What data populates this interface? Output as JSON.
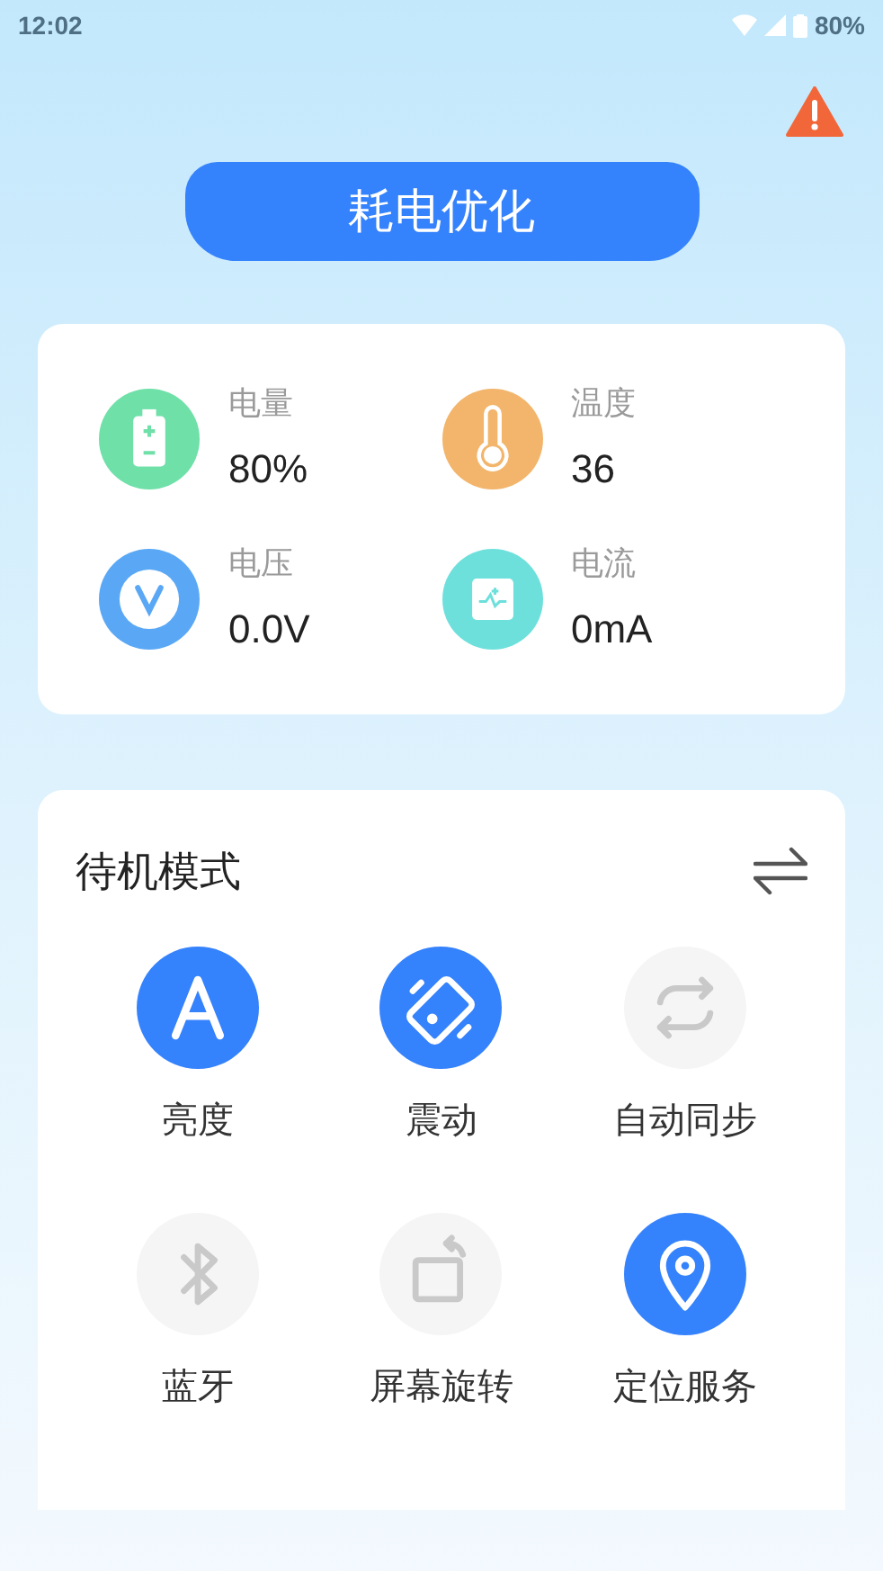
{
  "status_bar": {
    "time": "12:02",
    "battery": "80%"
  },
  "optimize_button": {
    "label": "耗电优化"
  },
  "stats": [
    {
      "kind": "battery",
      "label": "电量",
      "value": "80%",
      "color": "#6ee0a8"
    },
    {
      "kind": "temperature",
      "label": "温度",
      "value": "36",
      "color": "#f2b56b"
    },
    {
      "kind": "voltage",
      "label": "电压",
      "value": "0.0V",
      "color": "#5aa8f5"
    },
    {
      "kind": "current",
      "label": "电流",
      "value": "0mA",
      "color": "#6ee0dc"
    }
  ],
  "mode_panel": {
    "title": "待机模式",
    "toggles": [
      {
        "kind": "brightness",
        "label": "亮度",
        "on": true
      },
      {
        "kind": "vibrate",
        "label": "震动",
        "on": true
      },
      {
        "kind": "sync",
        "label": "自动同步",
        "on": false
      },
      {
        "kind": "bluetooth",
        "label": "蓝牙",
        "on": false
      },
      {
        "kind": "rotate",
        "label": "屏幕旋转",
        "on": false
      },
      {
        "kind": "location",
        "label": "定位服务",
        "on": true
      }
    ]
  }
}
